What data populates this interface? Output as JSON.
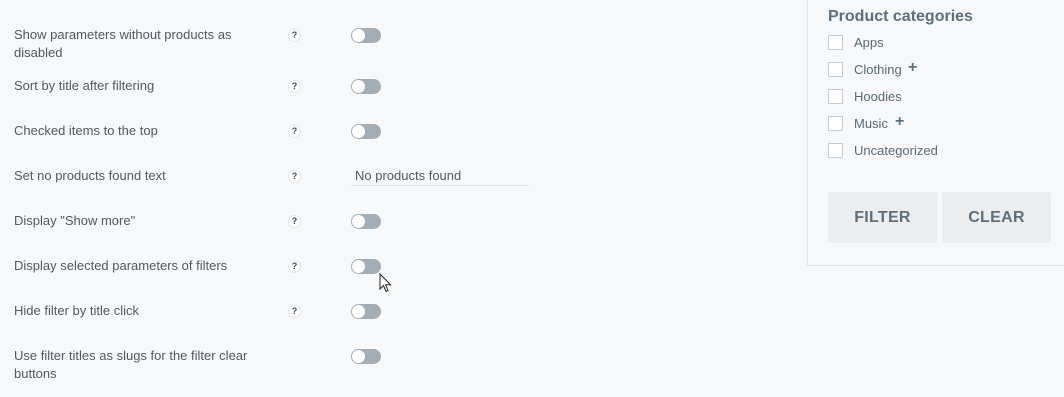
{
  "settings": {
    "help_symbol": "?",
    "rows": [
      {
        "label": "Show parameters without products as disabled"
      },
      {
        "label": "Sort by title after filtering"
      },
      {
        "label": "Checked items to the top"
      },
      {
        "label": "Set no products found text",
        "value": "No products found"
      },
      {
        "label": "Display \"Show more\""
      },
      {
        "label": "Display selected parameters of filters"
      },
      {
        "label": "Hide filter by title click"
      },
      {
        "label": "Use filter titles as slugs for the filter clear buttons"
      }
    ]
  },
  "preview": {
    "title": "Product categories",
    "categories": [
      {
        "label": "Apps"
      },
      {
        "label": "Clothing",
        "expand": "+"
      },
      {
        "label": "Hoodies"
      },
      {
        "label": "Music",
        "expand": "+"
      },
      {
        "label": "Uncategorized"
      }
    ],
    "filter_label": "FILTER",
    "clear_label": "CLEAR"
  },
  "colors": {
    "toggle_off": "#a3adb6",
    "accent": "#5c6f7d"
  },
  "icons": {
    "help": "question-icon",
    "expand": "plus-icon",
    "cursor": "mouse-cursor-icon"
  }
}
